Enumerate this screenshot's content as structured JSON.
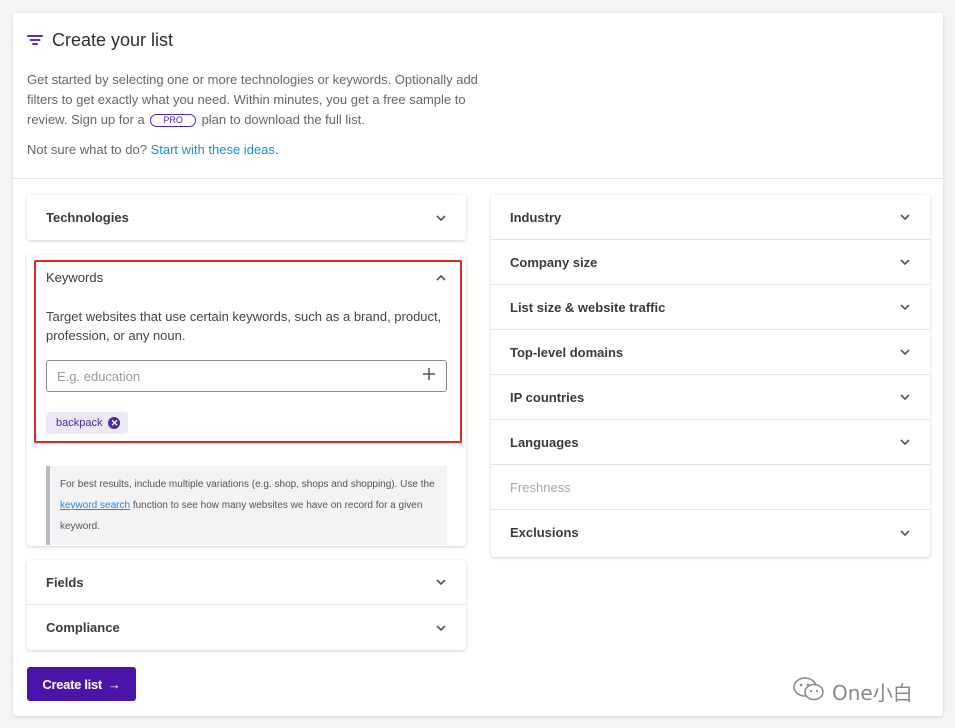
{
  "header": {
    "title": "Create your list",
    "intro_part1": "Get started by selecting one or more technologies or keywords. Optionally add filters to get exactly what you need. Within minutes, you get a free sample to review. Sign up for a",
    "pro_badge": "PRO",
    "intro_part2": "plan to download the full list.",
    "not_sure_text": "Not sure what to do?",
    "ideas_link": "Start with these ideas",
    "ideas_period": "."
  },
  "left": {
    "technologies": "Technologies",
    "keywords": {
      "label": "Keywords",
      "description": "Target websites that use certain keywords, such as a brand, product, profession, or any noun.",
      "input_placeholder": "E.g. education",
      "input_value": "",
      "tags": [
        "backpack"
      ],
      "tip_part1": "For best results, include multiple variations (e.g. shop, shops and shopping). Use the",
      "tip_link": "keyword search",
      "tip_part2": "function to see how many websites we have on record for a given keyword."
    },
    "fields": "Fields",
    "compliance": "Compliance"
  },
  "right": {
    "items": [
      {
        "label": "Industry",
        "disabled": false
      },
      {
        "label": "Company size",
        "disabled": false
      },
      {
        "label": "List size & website traffic",
        "disabled": false
      },
      {
        "label": "Top-level domains",
        "disabled": false
      },
      {
        "label": "IP countries",
        "disabled": false
      },
      {
        "label": "Languages",
        "disabled": false
      },
      {
        "label": "Freshness",
        "disabled": true
      },
      {
        "label": "Exclusions",
        "disabled": false
      }
    ]
  },
  "actions": {
    "create_list": "Create list",
    "create_arrow": "→"
  },
  "watermark": {
    "text": "One小白"
  },
  "colors": {
    "accent": "#4b14a8",
    "link": "#1f8ad6",
    "highlight": "#e02525"
  }
}
